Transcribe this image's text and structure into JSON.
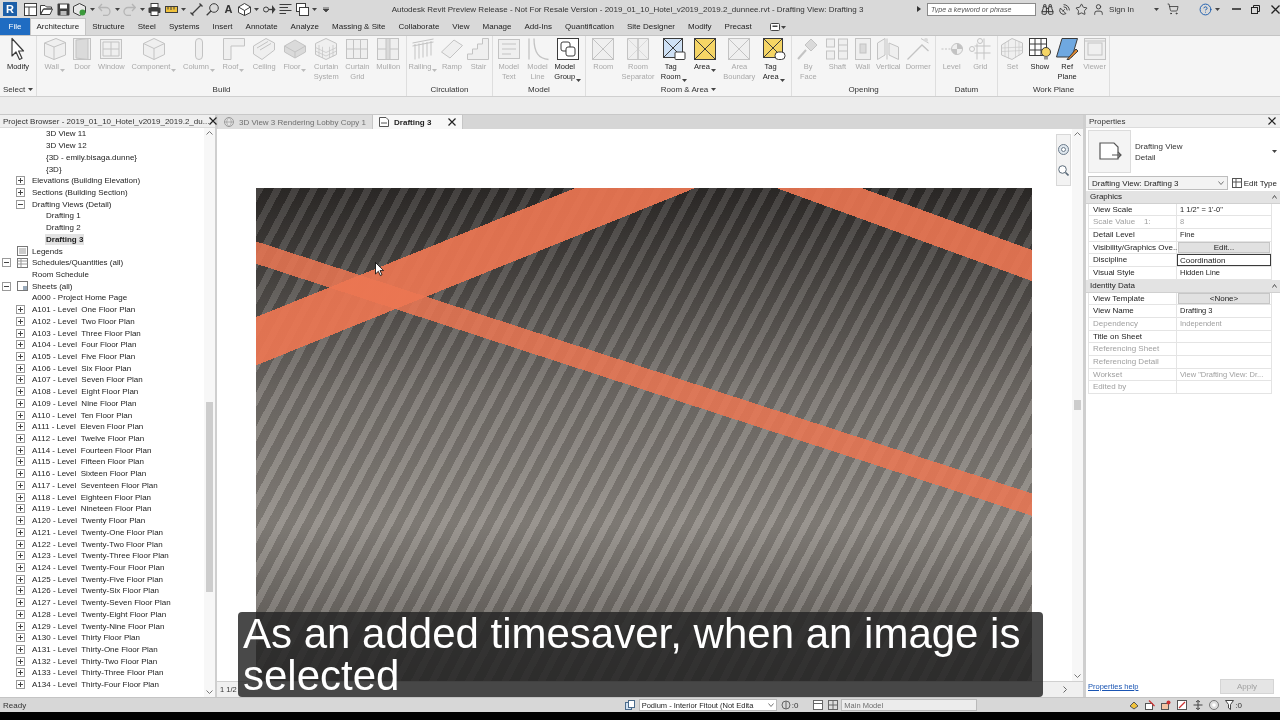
{
  "title_bar": {
    "logo": "R",
    "undo": {
      "disabled": true
    },
    "redo": {
      "disabled": true
    },
    "text_tool": "A",
    "title": "Autodesk Revit Preview Release - Not For Resale Version - 2019_01_10_Hotel_v2019_2019.2_dunnee.rvt - Drafting View: Drafting 3",
    "search": {
      "placeholder": "Type a keyword or phrase"
    },
    "sign_in": "Sign In"
  },
  "ribbon_tabs": [
    {
      "label": "File",
      "kind": "application",
      "selected": false
    },
    {
      "label": "Architecture",
      "kind": "tab",
      "selected": true
    },
    {
      "label": "Structure",
      "kind": "tab",
      "selected": false
    },
    {
      "label": "Steel",
      "kind": "tab",
      "selected": false
    },
    {
      "label": "Systems",
      "kind": "tab",
      "selected": false
    },
    {
      "label": "Insert",
      "kind": "tab",
      "selected": false
    },
    {
      "label": "Annotate",
      "kind": "tab",
      "selected": false
    },
    {
      "label": "Analyze",
      "kind": "tab",
      "selected": false
    },
    {
      "label": "Massing & Site",
      "kind": "tab",
      "selected": false
    },
    {
      "label": "Collaborate",
      "kind": "tab",
      "selected": false
    },
    {
      "label": "View",
      "kind": "tab",
      "selected": false
    },
    {
      "label": "Manage",
      "kind": "tab",
      "selected": false
    },
    {
      "label": "Add-Ins",
      "kind": "tab",
      "selected": false
    },
    {
      "label": "Quantification",
      "kind": "tab",
      "selected": false
    },
    {
      "label": "Site Designer",
      "kind": "tab",
      "selected": false
    },
    {
      "label": "Modify",
      "kind": "tab",
      "selected": false
    },
    {
      "label": "Precast",
      "kind": "tab",
      "selected": false
    }
  ],
  "ribbon_panels": [
    {
      "title": "Select",
      "menu": true,
      "buttons": [
        {
          "label": "Modify",
          "disabled": false,
          "dropdown": false
        }
      ]
    },
    {
      "title": "Build",
      "menu": false,
      "buttons": [
        {
          "label": "Wall",
          "disabled": true,
          "dropdown": true
        },
        {
          "label": "Door",
          "disabled": true,
          "dropdown": false
        },
        {
          "label": "Window",
          "disabled": true,
          "dropdown": false
        },
        {
          "label": "Component",
          "disabled": true,
          "dropdown": true
        },
        {
          "label": "Column",
          "disabled": true,
          "dropdown": true
        },
        {
          "label": "Roof",
          "disabled": true,
          "dropdown": true
        },
        {
          "label": "Ceiling",
          "disabled": true,
          "dropdown": false
        },
        {
          "label": "Floor",
          "disabled": true,
          "dropdown": true
        },
        {
          "label": "Curtain System",
          "disabled": true,
          "dropdown": false
        },
        {
          "label": "Curtain Grid",
          "disabled": true,
          "dropdown": false
        },
        {
          "label": "Mullion",
          "disabled": true,
          "dropdown": false
        }
      ]
    },
    {
      "title": "Circulation",
      "menu": false,
      "buttons": [
        {
          "label": "Railing",
          "disabled": true,
          "dropdown": true
        },
        {
          "label": "Ramp",
          "disabled": true,
          "dropdown": false
        },
        {
          "label": "Stair",
          "disabled": true,
          "dropdown": false
        }
      ]
    },
    {
      "title": "Model",
      "menu": false,
      "buttons": [
        {
          "label": "Model Text",
          "disabled": true,
          "dropdown": false
        },
        {
          "label": "Model Line",
          "disabled": true,
          "dropdown": false
        },
        {
          "label": "Model Group",
          "disabled": false,
          "dropdown": true
        }
      ]
    },
    {
      "title": "Room & Area",
      "menu": true,
      "buttons": [
        {
          "label": "Room",
          "disabled": true,
          "dropdown": false
        },
        {
          "label": "Room Separator",
          "disabled": true,
          "dropdown": false
        },
        {
          "label": "Tag Room",
          "disabled": false,
          "dropdown": true
        },
        {
          "label": "Area",
          "disabled": false,
          "dropdown": true
        },
        {
          "label": "Area Boundary",
          "disabled": true,
          "dropdown": false
        },
        {
          "label": "Tag Area",
          "disabled": false,
          "dropdown": true
        }
      ]
    },
    {
      "title": "Opening",
      "menu": false,
      "buttons": [
        {
          "label": "By Face",
          "disabled": true,
          "dropdown": false
        },
        {
          "label": "Shaft",
          "disabled": true,
          "dropdown": false
        },
        {
          "label": "Wall",
          "disabled": true,
          "dropdown": false
        },
        {
          "label": "Vertical",
          "disabled": true,
          "dropdown": false
        },
        {
          "label": "Dormer",
          "disabled": true,
          "dropdown": false
        }
      ]
    },
    {
      "title": "Datum",
      "menu": false,
      "buttons": [
        {
          "label": "Level",
          "disabled": true,
          "dropdown": false
        },
        {
          "label": "Grid",
          "disabled": true,
          "dropdown": false
        }
      ]
    },
    {
      "title": "Work Plane",
      "menu": false,
      "buttons": [
        {
          "label": "Set",
          "disabled": true,
          "dropdown": false
        },
        {
          "label": "Show",
          "disabled": false,
          "dropdown": false
        },
        {
          "label": "Ref Plane",
          "disabled": false,
          "dropdown": false
        },
        {
          "label": "Viewer",
          "disabled": true,
          "dropdown": false
        }
      ]
    }
  ],
  "project_browser": {
    "title": "Project Browser - 2019_01_10_Hotel_v2019_2019.2_du...",
    "tree": [
      {
        "children": [
          {
            "children": [
              {
                "label": "3D View 11",
                "selected": false
              },
              {
                "label": "3D View 12",
                "selected": false
              },
              {
                "label": "{3D - emily.bisaga.dunne}",
                "selected": false
              },
              {
                "label": "{3D}",
                "selected": false
              }
            ]
          },
          {
            "label": "Elevations (Building Elevation)",
            "selected": false,
            "expanded": false
          },
          {
            "label": "Sections (Building Section)",
            "selected": false,
            "expanded": false
          },
          {
            "label": "Drafting Views (Detail)",
            "selected": false,
            "expanded": true,
            "children": [
              {
                "label": "Drafting 1",
                "selected": false
              },
              {
                "label": "Drafting 2",
                "selected": false
              },
              {
                "label": "Drafting 3",
                "selected": true
              }
            ]
          }
        ]
      },
      {
        "label": "Legends",
        "kind": "legends",
        "selected": false
      },
      {
        "label": "Schedules/Quantities (all)",
        "kind": "schedules",
        "selected": false,
        "expanded": true,
        "children": [
          {
            "label": "Room Schedule",
            "selected": false
          }
        ]
      },
      {
        "label": "Sheets (all)",
        "kind": "sheets",
        "selected": false,
        "expanded": true,
        "children": [
          {
            "label": "A000 - Project Home Page",
            "selected": false
          },
          {
            "label": "A101 - Level  One Floor Plan",
            "selected": false,
            "expanded": false
          },
          {
            "label": "A102 - Level  Two Floor Plan",
            "selected": false,
            "expanded": false
          },
          {
            "label": "A103 - Level  Three Floor Plan",
            "selected": false,
            "expanded": false
          },
          {
            "label": "A104 - Level  Four Floor Plan",
            "selected": false,
            "expanded": false
          },
          {
            "label": "A105 - Level  Five Floor Plan",
            "selected": false,
            "expanded": false
          },
          {
            "label": "A106 - Level  Six Floor Plan",
            "selected": false,
            "expanded": false
          },
          {
            "label": "A107 - Level  Seven Floor Plan",
            "selected": false,
            "expanded": false
          },
          {
            "label": "A108 - Level  Eight Floor Plan",
            "selected": false,
            "expanded": false
          },
          {
            "label": "A109 - Level  Nine Floor Plan",
            "selected": false,
            "expanded": false
          },
          {
            "label": "A110 - Level  Ten Floor Plan",
            "selected": false,
            "expanded": false
          },
          {
            "label": "A111 - Level  Eleven Floor Plan",
            "selected": false,
            "expanded": false
          },
          {
            "label": "A112 - Level  Twelve Floor Plan",
            "selected": false,
            "expanded": false
          },
          {
            "label": "A114 - Level  Fourteen Floor Plan",
            "selected": false,
            "expanded": false
          },
          {
            "label": "A115 - Level  Fifteen Floor Plan",
            "selected": false,
            "expanded": false
          },
          {
            "label": "A116 - Level  Sixteen Floor Plan",
            "selected": false,
            "expanded": false
          },
          {
            "label": "A117 - Level  Seventeen Floor Plan",
            "selected": false,
            "expanded": false
          },
          {
            "label": "A118 - Level  Eighteen Floor Plan",
            "selected": false,
            "expanded": false
          },
          {
            "label": "A119 - Level  Nineteen Floor Plan",
            "selected": false,
            "expanded": false
          },
          {
            "label": "A120 - Level  Twenty Floor Plan",
            "selected": false,
            "expanded": false
          },
          {
            "label": "A121 - Level  Twenty-One Floor Plan",
            "selected": false,
            "expanded": false
          },
          {
            "label": "A122 - Level  Twenty-Two Floor Plan",
            "selected": false,
            "expanded": false
          },
          {
            "label": "A123 - Level  Twenty-Three Floor Plan",
            "selected": false,
            "expanded": false
          },
          {
            "label": "A124 - Level  Twenty-Four Floor Plan",
            "selected": false,
            "expanded": false
          },
          {
            "label": "A125 - Level  Twenty-Five Floor Plan",
            "selected": false,
            "expanded": false
          },
          {
            "label": "A126 - Level  Twenty-Six Floor Plan",
            "selected": false,
            "expanded": false
          },
          {
            "label": "A127 - Level  Twenty-Seven Floor Plan",
            "selected": false,
            "expanded": false
          },
          {
            "label": "A128 - Level  Twenty-Eight Floor Plan",
            "selected": false,
            "expanded": false
          },
          {
            "label": "A129 - Level  Twenty-Nine Floor Plan",
            "selected": false,
            "expanded": false
          },
          {
            "label": "A130 - Level  Thirty Floor Plan",
            "selected": false,
            "expanded": false
          },
          {
            "label": "A131 - Level  Thirty-One Floor Plan",
            "selected": false,
            "expanded": false
          },
          {
            "label": "A132 - Level  Thirty-Two Floor Plan",
            "selected": false,
            "expanded": false
          },
          {
            "label": "A133 - Level  Thirty-Three Floor Plan",
            "selected": false,
            "expanded": false
          },
          {
            "label": "A134 - Level  Thirty-Four Floor Plan",
            "selected": false,
            "expanded": false
          }
        ]
      }
    ]
  },
  "view_tabs": [
    {
      "label": "3D View 3 Rendering Lobby Copy 1",
      "kind": "model",
      "selected": false
    },
    {
      "label": "Drafting 3",
      "kind": "drafting",
      "selected": true
    }
  ],
  "view": {
    "scale": "1 1/2"
  },
  "properties": {
    "title": "Properties",
    "type": {
      "family": "Drafting View",
      "name": "Detail"
    },
    "instance": "Drafting View: Drafting 3",
    "edit_type": "Edit Type",
    "groups": [
      {
        "title": "Graphics",
        "expanded": true,
        "rows": [
          {
            "label": "View Scale",
            "value": "1 1/2\" = 1'-0\"",
            "kind": "text",
            "disabled": false
          },
          {
            "label": "Scale Value    1:",
            "value": "8",
            "kind": "text",
            "disabled": true
          },
          {
            "label": "Detail Level",
            "value": "Fine",
            "kind": "text",
            "disabled": false
          },
          {
            "label": "Visibility/Graphics Ove...",
            "value": "Edit...",
            "kind": "button",
            "disabled": false
          },
          {
            "label": "Discipline",
            "value": "Coordination",
            "kind": "input",
            "disabled": false
          },
          {
            "label": "Visual Style",
            "value": "Hidden Line",
            "kind": "text",
            "disabled": false
          }
        ]
      },
      {
        "title": "Identity Data",
        "expanded": true,
        "rows": [
          {
            "label": "View Template",
            "value": "<None>",
            "kind": "button",
            "disabled": false
          },
          {
            "label": "View Name",
            "value": "Drafting 3",
            "kind": "text",
            "disabled": false
          },
          {
            "label": "Dependency",
            "value": "Independent",
            "kind": "text",
            "disabled": true
          },
          {
            "label": "Title on Sheet",
            "kind": "text",
            "disabled": false
          },
          {
            "label": "Referencing Sheet",
            "kind": "text",
            "disabled": true
          },
          {
            "label": "Referencing Detail",
            "kind": "text",
            "disabled": true
          },
          {
            "label": "Workset",
            "value": "View \"Drafting View: Dr...",
            "kind": "text",
            "disabled": true
          },
          {
            "label": "Edited by",
            "kind": "text",
            "disabled": true
          }
        ]
      }
    ],
    "help": "Properties help",
    "apply": {
      "label": "Apply",
      "disabled": true
    }
  },
  "status_bar": {
    "message": "Ready",
    "workset": "Podium - Interior Fitout (Not Edita",
    "workset_count": ":0",
    "design_option": {
      "value": "Main Model",
      "disabled": true
    },
    "filter_count": ":0"
  },
  "caption": "As an added timesaver, when an image is selected"
}
